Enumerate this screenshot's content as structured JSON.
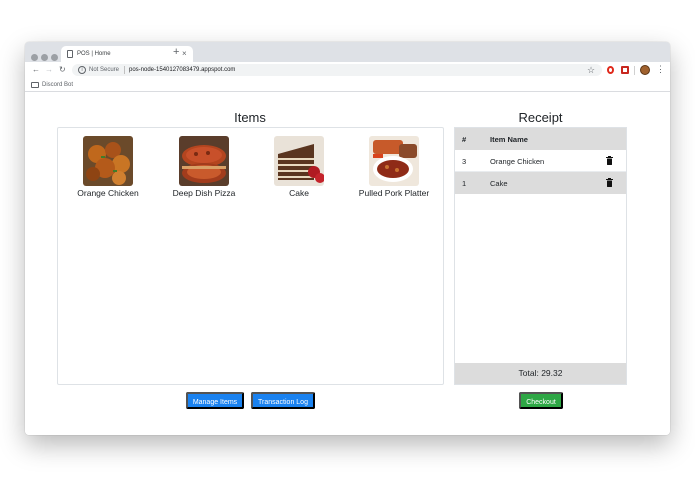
{
  "browser": {
    "tab_title": "POS | Home",
    "tab_close": "×",
    "new_tab": "+",
    "not_secure": "Not Secure",
    "url": "pos-node-1540127083479.appspot.com",
    "bookmark": "Discord Bot"
  },
  "items_section": {
    "title": "Items",
    "items": [
      {
        "name": "Orange Chicken"
      },
      {
        "name": "Deep Dish Pizza"
      },
      {
        "name": "Cake"
      },
      {
        "name": "Pulled Pork Platter"
      }
    ]
  },
  "receipt": {
    "title": "Receipt",
    "columns": [
      "#",
      "Item Name"
    ],
    "rows": [
      {
        "num": "3",
        "name": "Orange Chicken"
      },
      {
        "num": "1",
        "name": "Cake"
      }
    ],
    "total": "Total: 29.32"
  },
  "buttons": {
    "manage_items": "Manage Items",
    "transaction_log": "Transaction Log",
    "checkout": "Checkout"
  },
  "colors": {
    "primary": "#1a82f0",
    "success": "#2ea745",
    "table_header": "#dcdcdc"
  }
}
